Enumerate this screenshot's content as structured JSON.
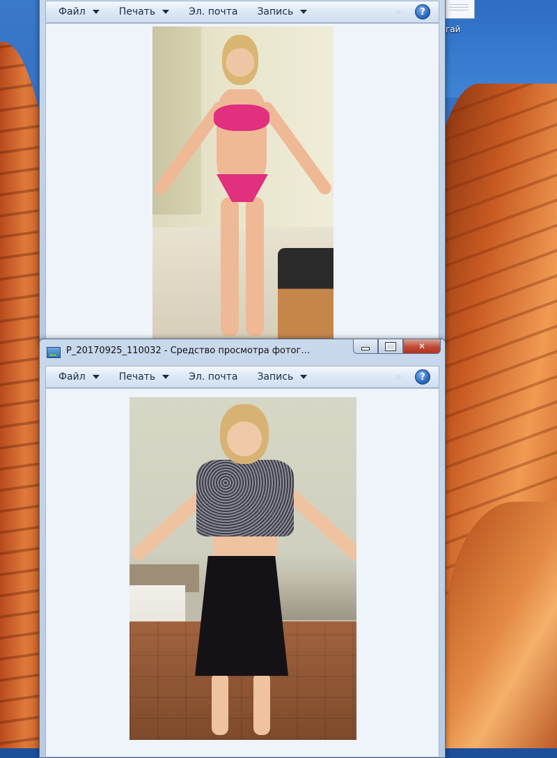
{
  "desktop": {
    "icon_label": "гай"
  },
  "windows": [
    {
      "title": "",
      "toolbar": {
        "file": "Файл",
        "print": "Печать",
        "email": "Эл. почта",
        "burn": "Запись",
        "help": "?"
      },
      "photo": {
        "icon": "photo-image"
      }
    },
    {
      "title": "P_20170925_110032 - Средство просмотра фотог…",
      "buttons": {
        "minimize": "minimize-icon",
        "maximize": "maximize-icon",
        "close": "✕"
      },
      "toolbar": {
        "file": "Файл",
        "print": "Печать",
        "email": "Эл. почта",
        "burn": "Запись",
        "help": "?"
      },
      "photo": {
        "icon": "photo-image"
      }
    }
  ]
}
